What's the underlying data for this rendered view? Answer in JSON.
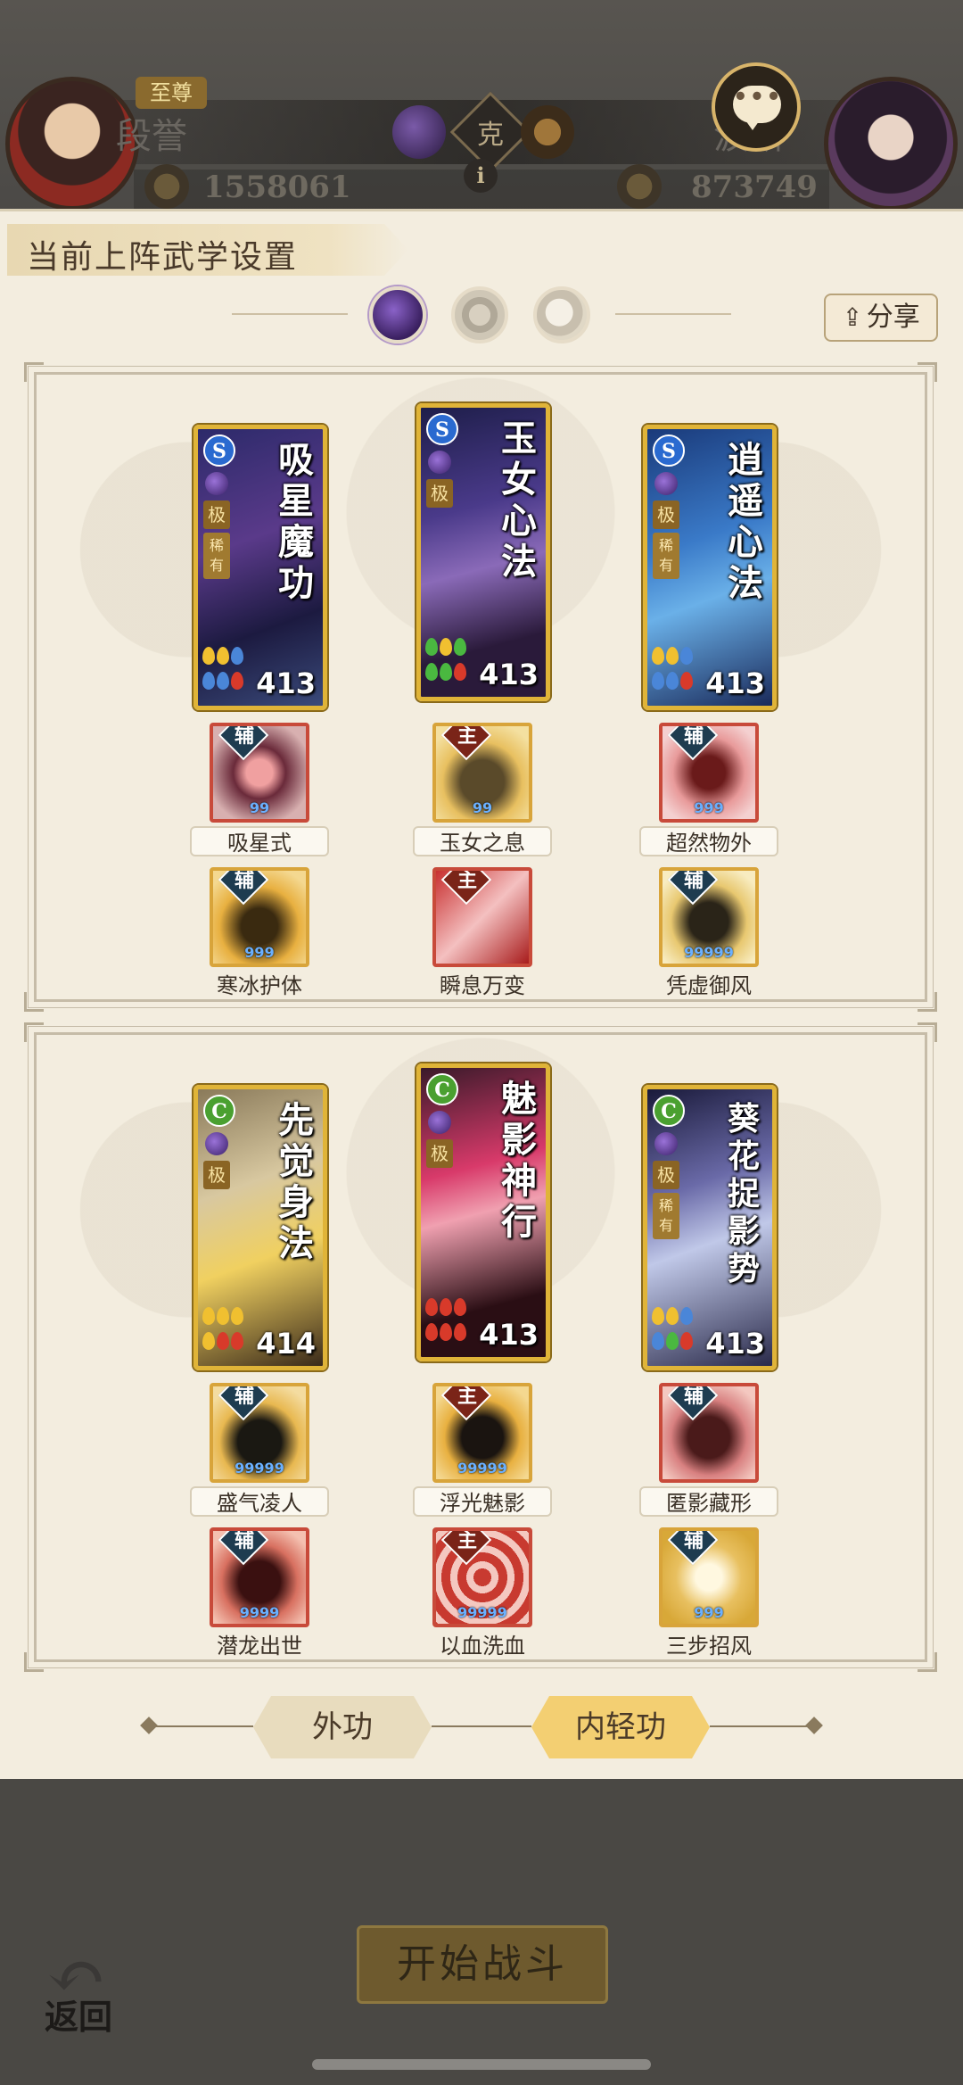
{
  "header": {
    "rank_badge": "至尊",
    "player_left_name": "段誉",
    "player_left_score": "1558061",
    "player_right_name": "波斯",
    "player_right_score": "873749",
    "vs_label": "克",
    "info_label": "i",
    "chat_label": "•••"
  },
  "panel": {
    "title": "当前上阵武学设置",
    "share_label": "分享",
    "share_icon": "share-icon"
  },
  "groups": [
    {
      "cards": [
        {
          "title": "吸星魔功",
          "type": "S",
          "grade": "极",
          "rarity": "稀有",
          "power": "413"
        },
        {
          "title": "玉女心法",
          "type": "S",
          "grade": "极",
          "rarity": "",
          "power": "413"
        },
        {
          "title": "逍遥心法",
          "type": "S",
          "grade": "极",
          "rarity": "稀有",
          "power": "413"
        }
      ],
      "skills": [
        {
          "tag": "辅",
          "name": "吸星式",
          "level": "99"
        },
        {
          "tag": "主",
          "name": "玉女之息",
          "level": "99"
        },
        {
          "tag": "辅",
          "name": "超然物外",
          "level": "999"
        },
        {
          "tag": "辅",
          "name": "寒冰护体",
          "level": "999"
        },
        {
          "tag": "主",
          "name": "瞬息万变",
          "level": ""
        },
        {
          "tag": "辅",
          "name": "凭虚御风",
          "level": "99999"
        }
      ]
    },
    {
      "cards": [
        {
          "title": "先觉身法",
          "type": "C",
          "grade": "极",
          "rarity": "",
          "power": "414"
        },
        {
          "title": "魅影神行",
          "type": "C",
          "grade": "极",
          "rarity": "",
          "power": "413"
        },
        {
          "title": "葵花捉影势",
          "type": "C",
          "grade": "极",
          "rarity": "稀有",
          "power": "413"
        }
      ],
      "skills": [
        {
          "tag": "辅",
          "name": "盛气凌人",
          "level": "99999"
        },
        {
          "tag": "主",
          "name": "浮光魅影",
          "level": "99999"
        },
        {
          "tag": "辅",
          "name": "匿影藏形",
          "level": ""
        },
        {
          "tag": "辅",
          "name": "潜龙出世",
          "level": "9999"
        },
        {
          "tag": "主",
          "name": "以血洗血",
          "level": "99999"
        },
        {
          "tag": "辅",
          "name": "三步招风",
          "level": "999"
        }
      ]
    }
  ],
  "mode_tabs": {
    "outer": "外功",
    "inner": "内轻功",
    "selected": "inner"
  },
  "footer": {
    "back_label": "返回",
    "start_label": "开始战斗"
  },
  "colors": {
    "panel_bg": "#f3eddf",
    "card_frame": "#e0b438",
    "selected_tab": "#f3cf72",
    "overlay": "#4a4844"
  }
}
